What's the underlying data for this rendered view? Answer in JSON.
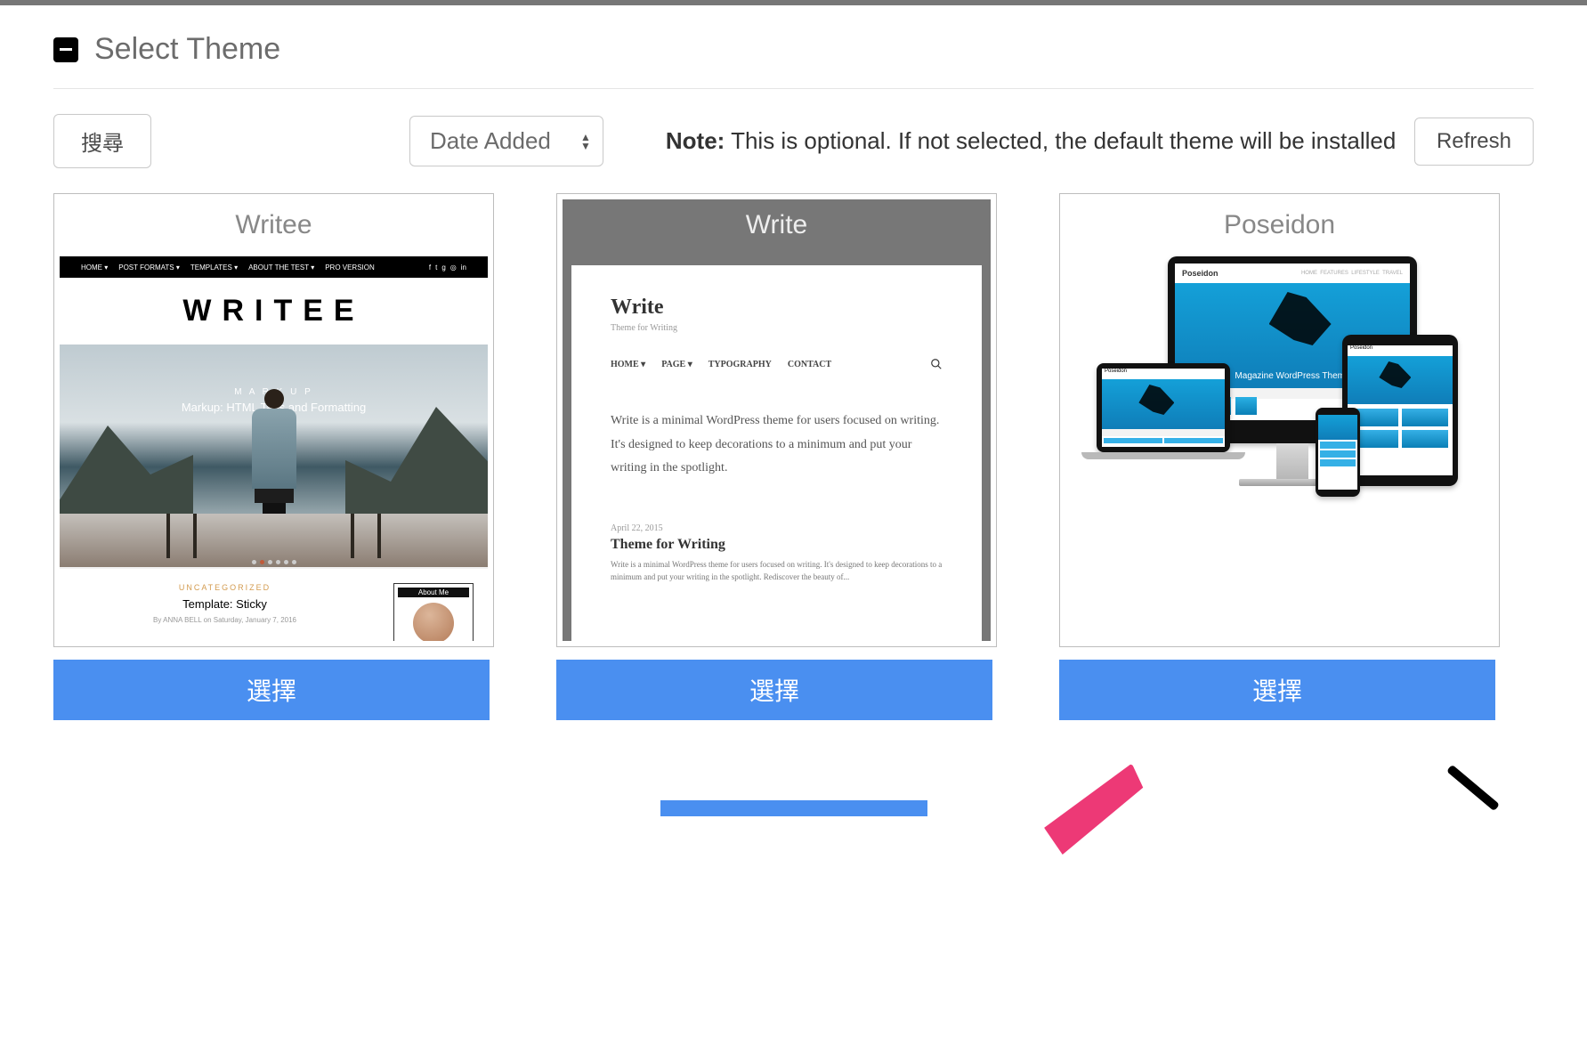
{
  "heading": "Select Theme",
  "controls": {
    "search_label": "搜尋",
    "sort_label": "Date Added",
    "refresh_label": "Refresh"
  },
  "note": {
    "prefix": "Note:",
    "body": "This is optional. If not selected, the default theme will be installed"
  },
  "themes": [
    {
      "name": "Writee",
      "select_label": "選擇",
      "preview": {
        "nav": [
          "HOME ▾",
          "POST FORMATS ▾",
          "TEMPLATES ▾",
          "ABOUT THE TEST ▾",
          "PRO VERSION"
        ],
        "logo": "WRITEE",
        "hero_kicker": "M A R K U P",
        "hero_text": "Markup: HTML Tags and Formatting",
        "category": "UNCATEGORIZED",
        "article_title": "Template: Sticky",
        "meta": "By ANNA BELL on Saturday, January 7, 2016",
        "sidebar_label": "About Me"
      }
    },
    {
      "name": "Write",
      "select_label": "選擇",
      "preview": {
        "heading": "Write",
        "tagline": "Theme for Writing",
        "nav": [
          "HOME ▾",
          "PAGE ▾",
          "TYPOGRAPHY",
          "CONTACT"
        ],
        "paragraph": "Write is a minimal WordPress theme for users focused on writing. It's designed to keep decorations to a minimum and put your writing in the spotlight.",
        "date": "April 22, 2015",
        "h2": "Theme for Writing",
        "excerpt": "Write is a minimal WordPress theme for users focused on writing. It's designed to keep decorations to a minimum and put your writing in the spotlight. Rediscover the beauty of..."
      }
    },
    {
      "name": "Poseidon",
      "select_label": "選擇",
      "preview": {
        "brand": "Poseidon",
        "tagline": "Magazine WordPress Theme"
      }
    }
  ]
}
